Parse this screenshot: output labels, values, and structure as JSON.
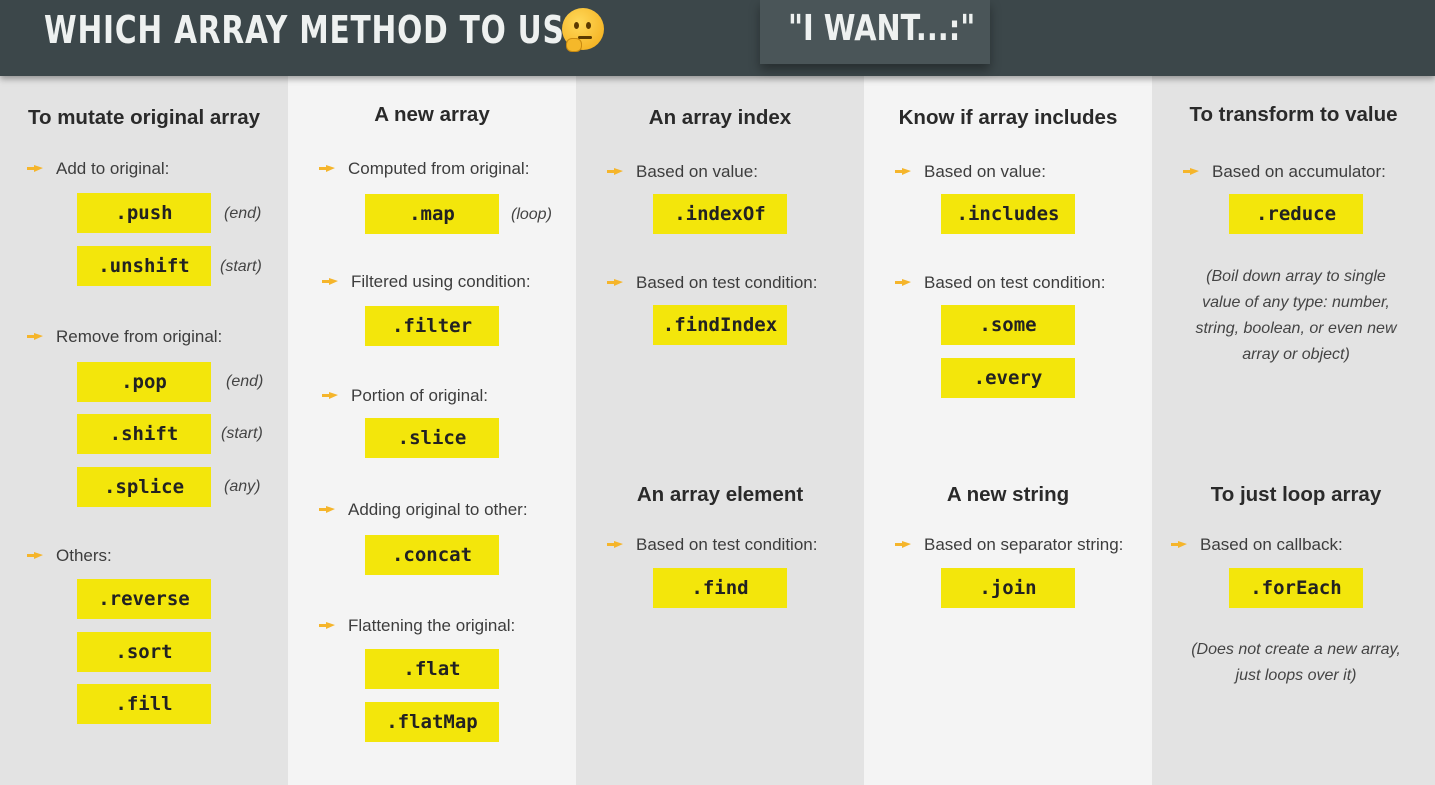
{
  "header": {
    "title": "WHICH ARRAY METHOD TO USE?",
    "tagline": "\"I WANT...:\""
  },
  "colors": {
    "header_bg": "#3c474a",
    "method_box": "#f3e60b",
    "bullet": "#f5b52b"
  },
  "icons": {
    "pointing_hand": "hand-pointing-right-icon",
    "thinking_face": "thinking-face-icon"
  },
  "columns": {
    "mutate": {
      "heading": "To mutate original array",
      "add": {
        "label": "Add to original:",
        "items": [
          {
            "method": ".push",
            "note": "(end)"
          },
          {
            "method": ".unshift",
            "note": "(start)"
          }
        ]
      },
      "remove": {
        "label": "Remove from original:",
        "items": [
          {
            "method": ".pop",
            "note": "(end)"
          },
          {
            "method": ".shift",
            "note": "(start)"
          },
          {
            "method": ".splice",
            "note": "(any)"
          }
        ]
      },
      "others": {
        "label": "Others:",
        "items": [
          {
            "method": ".reverse"
          },
          {
            "method": ".sort"
          },
          {
            "method": ".fill"
          }
        ]
      }
    },
    "new_array": {
      "heading": "A new array",
      "computed": {
        "label": "Computed from original:",
        "method": ".map",
        "note": "(loop)"
      },
      "filtered": {
        "label": "Filtered using condition:",
        "method": ".filter"
      },
      "portion": {
        "label": "Portion of original:",
        "method": ".slice"
      },
      "adding": {
        "label": "Adding original to other:",
        "method": ".concat"
      },
      "flattening": {
        "label": "Flattening the original:",
        "methods": [
          ".flat",
          ".flatMap"
        ]
      }
    },
    "index": {
      "heading": "An array index",
      "by_value": {
        "label": "Based on value:",
        "method": ".indexOf"
      },
      "by_test": {
        "label": "Based on test condition:",
        "method": ".findIndex"
      }
    },
    "element": {
      "heading": "An array element",
      "by_test": {
        "label": "Based on test condition:",
        "method": ".find"
      }
    },
    "includes": {
      "heading": "Know if array includes",
      "by_value": {
        "label": "Based on value:",
        "method": ".includes"
      },
      "by_test": {
        "label": "Based on test condition:",
        "methods": [
          ".some",
          ".every"
        ]
      }
    },
    "string": {
      "heading": "A new string",
      "by_separator": {
        "label": "Based on separator string:",
        "method": ".join"
      }
    },
    "transform": {
      "heading": "To transform to value",
      "by_accumulator": {
        "label": "Based on accumulator:",
        "method": ".reduce"
      },
      "description": [
        "(Boil down array to single",
        "value of any type: number,",
        "string, boolean, or even new",
        "array or object)"
      ]
    },
    "loop": {
      "heading": "To just loop array",
      "by_callback": {
        "label": "Based on callback:",
        "method": ".forEach"
      },
      "description": [
        "(Does not create a new array,",
        "just loops over it)"
      ]
    }
  }
}
